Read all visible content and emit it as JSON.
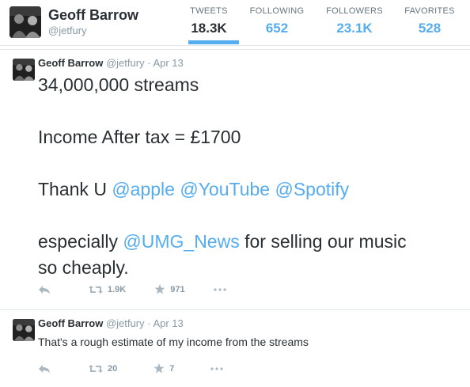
{
  "profile": {
    "name": "Geoff Barrow",
    "handle": "@jetfury",
    "stats": [
      {
        "label": "TWEETS",
        "value": "18.3K",
        "active": true
      },
      {
        "label": "FOLLOWING",
        "value": "652"
      },
      {
        "label": "FOLLOWERS",
        "value": "23.1K"
      },
      {
        "label": "FAVORITES",
        "value": "528"
      }
    ]
  },
  "tweets": [
    {
      "name": "Geoff Barrow",
      "handle": "@jetfury",
      "separator": "·",
      "date": "Apr 13",
      "lines": {
        "l1": "34,000,000 streams",
        "l2": "Income After tax = £1700",
        "l3_prefix": "Thank U ",
        "mention_apple": "@apple",
        "mention_youtube": "@YouTube",
        "mention_spotify": "@Spotify",
        "l4_prefix": "especially ",
        "mention_umg": "@UMG_News",
        "l4_suffix": " for selling our music",
        "l5": "so cheaply."
      },
      "retweets": "1.9K",
      "favorites": "971"
    },
    {
      "name": "Geoff Barrow",
      "handle": "@jetfury",
      "separator": "·",
      "date": "Apr 13",
      "text": "That's a rough estimate of my income from the streams",
      "retweets": "20",
      "favorites": "7"
    }
  ],
  "icons": {
    "reply": "reply-icon",
    "retweet": "retweet-icon",
    "favorite": "star-icon",
    "more": "more-icon"
  },
  "colors": {
    "accent": "#55acee",
    "text": "#292f33",
    "muted": "#8899a6",
    "border": "#e1e8ed"
  }
}
